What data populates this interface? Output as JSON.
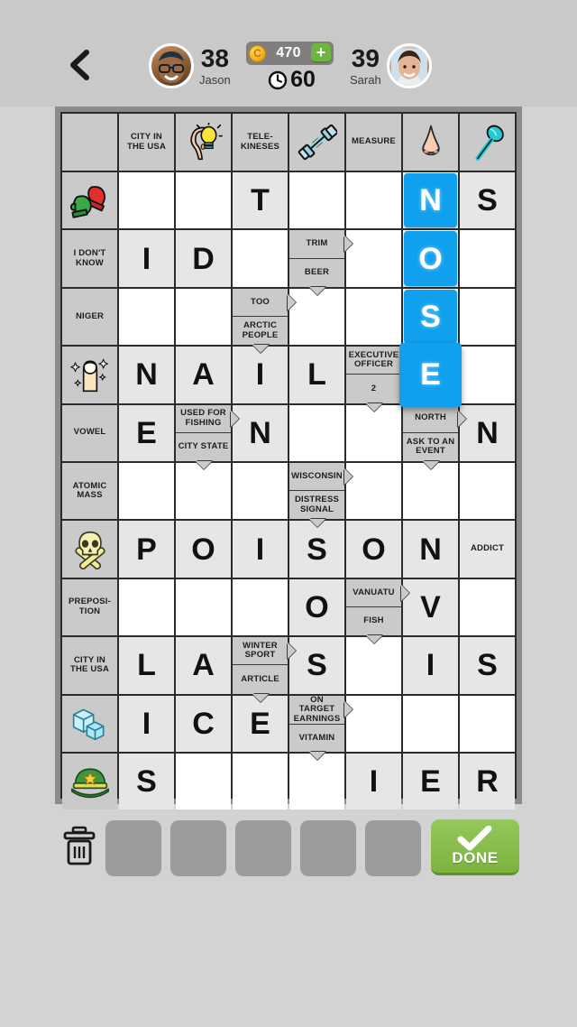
{
  "header": {
    "back_icon": "chevron-left-icon",
    "left_player": {
      "name": "Jason",
      "score": "38",
      "avatar_icon": "avatar-jason"
    },
    "right_player": {
      "name": "Sarah",
      "score": "39",
      "avatar_icon": "avatar-sarah"
    },
    "coins": {
      "value": "470",
      "icon": "coin-icon",
      "add_label": "+"
    },
    "timer": {
      "value": "60",
      "icon": "clock-icon"
    }
  },
  "grid": {
    "columns": 8,
    "rows": 12,
    "cells": [
      [
        {
          "t": "blank"
        },
        {
          "t": "clue",
          "text": "CITY IN THE USA"
        },
        {
          "t": "clue",
          "icon": "lightbulb-head-icon"
        },
        {
          "t": "clue",
          "text": "TELE-KINESES"
        },
        {
          "t": "clue",
          "icon": "dumbbell-icon"
        },
        {
          "t": "clue",
          "text": "MEASURE"
        },
        {
          "t": "clue",
          "icon": "nose-icon"
        },
        {
          "t": "clue",
          "icon": "spoon-icon"
        }
      ],
      [
        {
          "t": "clue",
          "icon": "mittens-icon"
        },
        {
          "t": "empty"
        },
        {
          "t": "empty"
        },
        {
          "t": "filled",
          "letter": "T"
        },
        {
          "t": "empty"
        },
        {
          "t": "empty"
        },
        {
          "t": "tile",
          "letter": "N"
        },
        {
          "t": "filled",
          "letter": "S"
        }
      ],
      [
        {
          "t": "clue",
          "text": "I DON'T KNOW"
        },
        {
          "t": "filled",
          "letter": "I"
        },
        {
          "t": "filled",
          "letter": "D"
        },
        {
          "t": "empty"
        },
        {
          "t": "split",
          "top": "TRIM",
          "bottom": "BEER",
          "arrow_right": true,
          "arrow_down": true
        },
        {
          "t": "empty"
        },
        {
          "t": "tile",
          "letter": "O"
        },
        {
          "t": "empty"
        }
      ],
      [
        {
          "t": "clue",
          "text": "NIGER"
        },
        {
          "t": "empty"
        },
        {
          "t": "empty"
        },
        {
          "t": "split",
          "top": "TOO",
          "bottom": "ARCTIC PEOPLE",
          "arrow_right": true,
          "arrow_down": true
        },
        {
          "t": "empty"
        },
        {
          "t": "empty"
        },
        {
          "t": "tile",
          "letter": "S"
        },
        {
          "t": "empty"
        }
      ],
      [
        {
          "t": "clue",
          "icon": "fingernail-icon"
        },
        {
          "t": "filled",
          "letter": "N"
        },
        {
          "t": "filled",
          "letter": "A"
        },
        {
          "t": "filled",
          "letter": "I"
        },
        {
          "t": "filled",
          "letter": "L"
        },
        {
          "t": "split",
          "top": "EXECUTIVE OFFICER",
          "bottom": "2",
          "arrow_right": true,
          "arrow_down": true
        },
        {
          "t": "tile",
          "letter": "E",
          "big": true
        },
        {
          "t": "empty"
        }
      ],
      [
        {
          "t": "clue",
          "text": "VOWEL"
        },
        {
          "t": "filled",
          "letter": "E"
        },
        {
          "t": "split",
          "top": "USED FOR FISHING",
          "bottom": "CITY STATE",
          "arrow_right": true,
          "arrow_down": true
        },
        {
          "t": "filled",
          "letter": "N"
        },
        {
          "t": "empty"
        },
        {
          "t": "empty"
        },
        {
          "t": "split",
          "top": "NORTH",
          "bottom": "ASK TO AN EVENT",
          "arrow_right": true,
          "arrow_down": true
        },
        {
          "t": "filled",
          "letter": "N"
        }
      ],
      [
        {
          "t": "clue",
          "text": "ATOMIC MASS"
        },
        {
          "t": "empty"
        },
        {
          "t": "empty"
        },
        {
          "t": "empty"
        },
        {
          "t": "split",
          "top": "WISCONSIN",
          "bottom": "DISTRESS SIGNAL",
          "arrow_right": true,
          "arrow_down": true
        },
        {
          "t": "empty"
        },
        {
          "t": "empty"
        },
        {
          "t": "empty"
        }
      ],
      [
        {
          "t": "clue",
          "icon": "skull-crossbones-icon"
        },
        {
          "t": "filled",
          "letter": "P"
        },
        {
          "t": "filled",
          "letter": "O"
        },
        {
          "t": "filled",
          "letter": "I"
        },
        {
          "t": "filled",
          "letter": "S"
        },
        {
          "t": "filled",
          "letter": "O"
        },
        {
          "t": "filled",
          "letter": "N"
        },
        {
          "t": "clue-light",
          "text": "ADDICT"
        }
      ],
      [
        {
          "t": "clue",
          "text": "PREPOSI-TION"
        },
        {
          "t": "empty"
        },
        {
          "t": "empty"
        },
        {
          "t": "empty"
        },
        {
          "t": "filled",
          "letter": "O"
        },
        {
          "t": "split",
          "top": "VANUATU",
          "bottom": "FISH",
          "arrow_right": true,
          "arrow_down": true
        },
        {
          "t": "filled",
          "letter": "V"
        },
        {
          "t": "empty"
        }
      ],
      [
        {
          "t": "clue",
          "text": "CITY IN THE USA"
        },
        {
          "t": "filled",
          "letter": "L"
        },
        {
          "t": "filled",
          "letter": "A"
        },
        {
          "t": "split",
          "top": "WINTER SPORT",
          "bottom": "ARTICLE",
          "arrow_right": true,
          "arrow_down": true
        },
        {
          "t": "filled",
          "letter": "S"
        },
        {
          "t": "empty"
        },
        {
          "t": "filled",
          "letter": "I"
        },
        {
          "t": "filled",
          "letter": "S"
        }
      ],
      [
        {
          "t": "clue",
          "icon": "ice-cubes-icon"
        },
        {
          "t": "filled",
          "letter": "I"
        },
        {
          "t": "filled",
          "letter": "C"
        },
        {
          "t": "filled",
          "letter": "E"
        },
        {
          "t": "split",
          "top": "ON TARGET EARNINGS",
          "bottom": "VITAMIN",
          "arrow_right": true,
          "arrow_down": true
        },
        {
          "t": "empty"
        },
        {
          "t": "empty"
        },
        {
          "t": "empty"
        }
      ],
      [
        {
          "t": "clue",
          "icon": "military-cap-icon"
        },
        {
          "t": "filled",
          "letter": "S"
        },
        {
          "t": "empty"
        },
        {
          "t": "empty"
        },
        {
          "t": "empty"
        },
        {
          "t": "filled",
          "letter": "I"
        },
        {
          "t": "filled",
          "letter": "E"
        },
        {
          "t": "filled",
          "letter": "R"
        }
      ]
    ]
  },
  "tray": {
    "trash_icon": "trash-icon",
    "rack_tiles": [
      "",
      "",
      "",
      "",
      ""
    ],
    "done_label": "DONE",
    "done_icon": "checkmark-icon"
  },
  "colors": {
    "tile_blue": "#10a0ee",
    "done_green": "#7cb33f",
    "clue_gray": "#cacaca",
    "filled_gray": "#e6e6e6",
    "background": "#d3d3d3"
  }
}
